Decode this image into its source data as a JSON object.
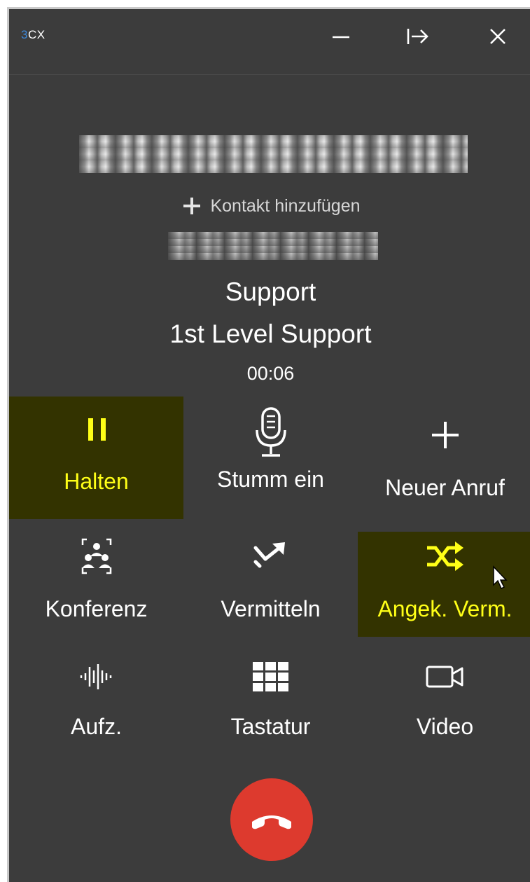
{
  "app": {
    "logo_prefix": "3",
    "logo_suffix": "CX"
  },
  "window_controls": [
    "minimize-icon",
    "dock-right-icon",
    "close-icon"
  ],
  "caller": {
    "number_redacted": true,
    "add_contact_label": "Kontakt hinzufügen",
    "extension_redacted": true,
    "queue": "Support",
    "group": "1st Level Support",
    "duration": "00:06"
  },
  "actions": {
    "hold": {
      "label": "Halten",
      "icon": "pause-icon",
      "active": true
    },
    "mute": {
      "label": "Stumm ein",
      "icon": "microphone-icon",
      "active": false
    },
    "new_call": {
      "label": "Neuer Anruf",
      "icon": "plus-icon",
      "active": false
    },
    "conference": {
      "label": "Konferenz",
      "icon": "conference-icon",
      "active": false
    },
    "transfer": {
      "label": "Vermitteln",
      "icon": "transfer-icon",
      "active": false
    },
    "attended_transfer": {
      "label": "Angek. Verm.",
      "icon": "shuffle-icon",
      "active": true
    },
    "record": {
      "label": "Aufz.",
      "icon": "waveform-icon",
      "active": false
    },
    "keypad": {
      "label": "Tastatur",
      "icon": "keypad-icon",
      "active": false
    },
    "video": {
      "label": "Video",
      "icon": "video-icon",
      "active": false
    }
  },
  "hangup": {
    "icon": "phone-hangup-icon"
  },
  "colors": {
    "background": "#3c3c3c",
    "active_bg": "#333300",
    "active_text": "#ffff17",
    "hangup": "#dd3a2e",
    "logo_accent": "#3d88d9"
  }
}
